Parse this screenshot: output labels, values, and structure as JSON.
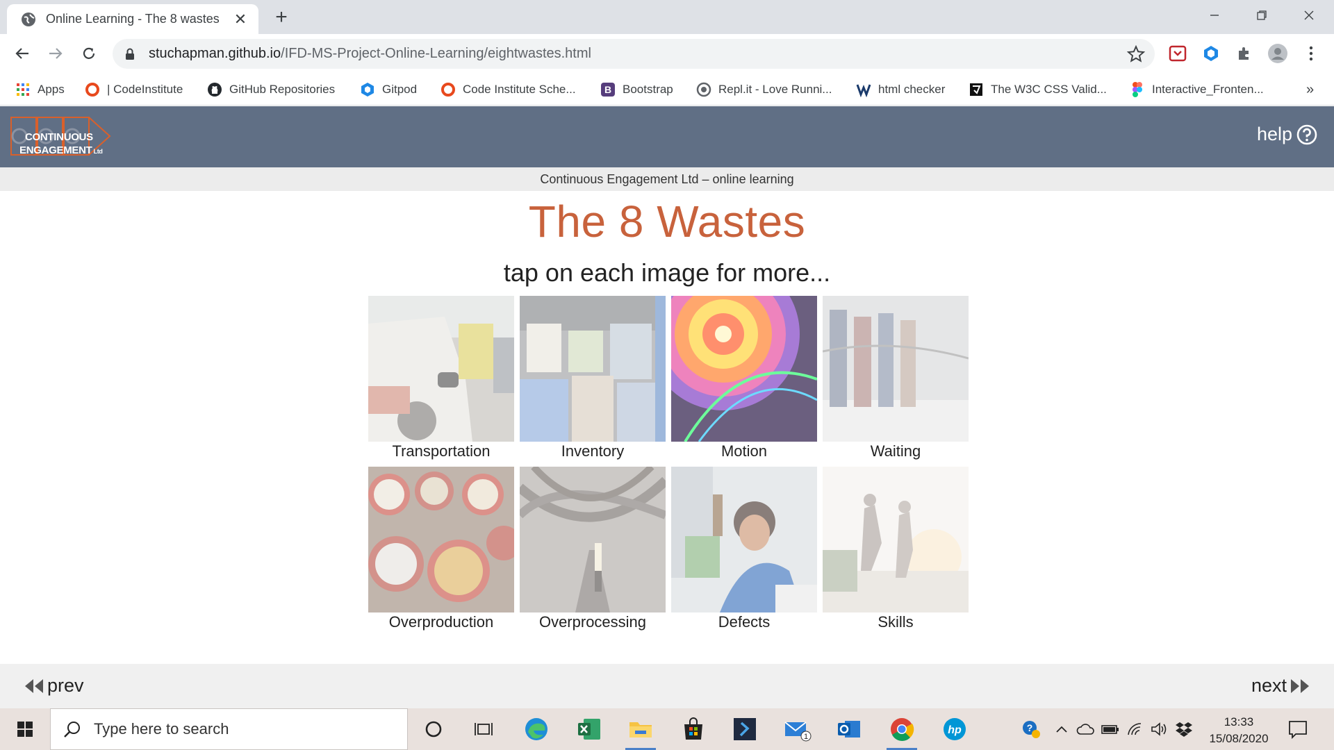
{
  "browser": {
    "tab_title": "Online Learning - The 8 wastes",
    "new_tab": "+",
    "url_host": "stuchapman.github.io",
    "url_path": "/IFD-MS-Project-Online-Learning/eightwastes.html",
    "bookmarks": [
      {
        "label": "Apps",
        "icon": "apps-grid-icon"
      },
      {
        "label": "| CodeInstitute",
        "icon": "codeinstitute-icon"
      },
      {
        "label": "GitHub Repositories",
        "icon": "github-icon"
      },
      {
        "label": "Gitpod",
        "icon": "gitpod-icon"
      },
      {
        "label": "Code Institute Sche...",
        "icon": "codeinstitute-icon"
      },
      {
        "label": "Bootstrap",
        "icon": "bootstrap-icon"
      },
      {
        "label": "Repl.it - Love Runni...",
        "icon": "replit-icon"
      },
      {
        "label": "html checker",
        "icon": "w3c-icon"
      },
      {
        "label": "The W3C CSS Valid...",
        "icon": "w3c-css-icon"
      },
      {
        "label": "Interactive_Fronten...",
        "icon": "figma-icon"
      }
    ],
    "bookmarks_more": "»"
  },
  "site": {
    "logo_line1": "CONTINUOUS",
    "logo_line2": "ENGAGEMENT",
    "logo_suffix": "Ltd",
    "help_label": "help",
    "subheader": "Continuous Engagement Ltd – online learning",
    "title": "The 8 Wastes",
    "subtitle": "tap on each image for more...",
    "wastes": [
      {
        "label": "Transportation"
      },
      {
        "label": "Inventory"
      },
      {
        "label": "Motion"
      },
      {
        "label": "Waiting"
      },
      {
        "label": "Overproduction"
      },
      {
        "label": "Overprocessing"
      },
      {
        "label": "Defects"
      },
      {
        "label": "Skills"
      }
    ],
    "prev_label": "prev",
    "next_label": "next"
  },
  "taskbar": {
    "search_placeholder": "Type here to search",
    "time": "13:33",
    "date": "15/08/2020",
    "mail_badge": "1"
  },
  "colors": {
    "header_bg": "#606f85",
    "title_accent": "#c8623c",
    "logo_accent": "#d9602b"
  }
}
